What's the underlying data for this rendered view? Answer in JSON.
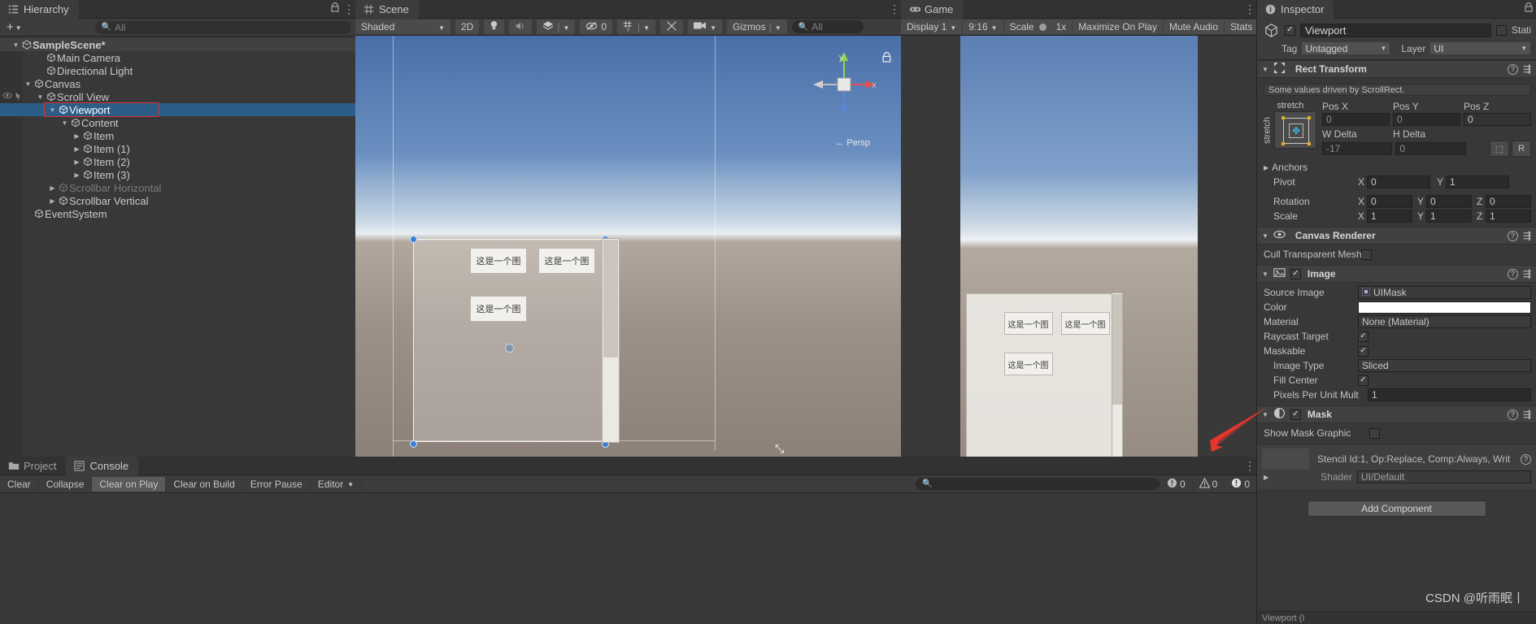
{
  "hierarchy": {
    "tab_label": "Hierarchy",
    "tab_icon": "hierarchy-icon",
    "add_label": "+",
    "search_placeholder": "All",
    "items": [
      {
        "label": "SampleScene*",
        "depth": 0,
        "tri": "down",
        "icon": "scene-icon",
        "state": "scene"
      },
      {
        "label": "Main Camera",
        "depth": 2,
        "tri": "none",
        "icon": "gameobject-icon",
        "state": "normal"
      },
      {
        "label": "Directional Light",
        "depth": 2,
        "tri": "none",
        "icon": "gameobject-icon",
        "state": "normal"
      },
      {
        "label": "Canvas",
        "depth": 1,
        "tri": "down",
        "icon": "gameobject-icon",
        "state": "normal"
      },
      {
        "label": "Scroll View",
        "depth": 2,
        "tri": "down",
        "icon": "gameobject-icon",
        "state": "normal"
      },
      {
        "label": "Viewport",
        "depth": 3,
        "tri": "down",
        "icon": "gameobject-icon",
        "state": "selected"
      },
      {
        "label": "Content",
        "depth": 4,
        "tri": "down",
        "icon": "gameobject-icon",
        "state": "normal"
      },
      {
        "label": "Item",
        "depth": 5,
        "tri": "right",
        "icon": "gameobject-icon",
        "state": "normal"
      },
      {
        "label": "Item (1)",
        "depth": 5,
        "tri": "right",
        "icon": "gameobject-icon",
        "state": "normal"
      },
      {
        "label": "Item (2)",
        "depth": 5,
        "tri": "right",
        "icon": "gameobject-icon",
        "state": "normal"
      },
      {
        "label": "Item (3)",
        "depth": 5,
        "tri": "right",
        "icon": "gameobject-icon",
        "state": "normal"
      },
      {
        "label": "Scrollbar Horizontal",
        "depth": 3,
        "tri": "right",
        "icon": "gameobject-icon",
        "state": "dim"
      },
      {
        "label": "Scrollbar Vertical",
        "depth": 3,
        "tri": "right",
        "icon": "gameobject-icon",
        "state": "normal"
      },
      {
        "label": "EventSystem",
        "depth": 1,
        "tri": "none",
        "icon": "gameobject-icon",
        "state": "normal"
      }
    ],
    "selection_highlight_color": "#e03030"
  },
  "scene": {
    "tab_label": "Scene",
    "tab_icon": "scene-grid-icon",
    "toolbar": {
      "draw_mode": "Shaded",
      "mode_2d": "2D",
      "lighting_icon": "lightbulb-icon",
      "audio_icon": "speaker-icon",
      "fx_icon": "effects-icon",
      "hidden_count": "0",
      "grid_icon": "grid-icon",
      "tools_icon": "tools-icon",
      "camera_icon": "camera-icon",
      "gizmos_label": "Gizmos",
      "search_placeholder": "All"
    },
    "gizmo": {
      "axis_x": "x",
      "axis_y": "y",
      "persp_label": "Persp"
    },
    "item_labels": [
      "这是一个图",
      "这是一个图",
      "这是一个图"
    ]
  },
  "game": {
    "tab_label": "Game",
    "tab_icon": "gamepad-icon",
    "toolbar": {
      "display": "Display 1",
      "aspect": "9:16",
      "scale_label": "Scale",
      "scale_value": "1x",
      "maximize_on_play": "Maximize On Play",
      "mute_audio": "Mute Audio",
      "stats": "Stats"
    },
    "item_labels": [
      "这是一个图",
      "这是一个图",
      "这是一个图"
    ]
  },
  "inspector": {
    "tab_label": "Inspector",
    "tab_icon": "info-icon",
    "lock_icon": "lock-icon",
    "object": {
      "enabled": true,
      "name": "Viewport",
      "static_label": "Stati",
      "static_checked": false,
      "tag_label": "Tag",
      "tag_value": "Untagged",
      "layer_label": "Layer",
      "layer_value": "UI"
    },
    "components": [
      {
        "id": "rect-transform",
        "title": "Rect Transform",
        "icon": "rect-transform-icon",
        "has_toggle": false,
        "help_box": "Some values driven by ScrollRect.",
        "anchor_preset_label": "stretch",
        "anchor_stretch_label": "stretch",
        "fields": {
          "pos_x_label": "Pos X",
          "pos_x": "0",
          "pos_y_label": "Pos Y",
          "pos_y": "0",
          "pos_z_label": "Pos Z",
          "pos_z": "0",
          "w_delta_label": "W Delta",
          "w_delta": "-17",
          "h_delta_label": "H Delta",
          "h_delta": "0",
          "anchors_label": "Anchors",
          "pivot_label": "Pivot",
          "pivot_x": "0",
          "pivot_y": "1",
          "rotation_label": "Rotation",
          "rot_x": "0",
          "rot_y": "0",
          "rot_z": "0",
          "scale_label": "Scale",
          "scale_x": "1",
          "scale_y": "1",
          "scale_z": "1"
        }
      },
      {
        "id": "canvas-renderer",
        "title": "Canvas Renderer",
        "icon": "canvas-renderer-icon",
        "has_toggle": false,
        "props": [
          {
            "label": "Cull Transparent Mesh",
            "type": "checkbox",
            "value": false
          }
        ]
      },
      {
        "id": "image",
        "title": "Image",
        "icon": "image-icon",
        "has_toggle": true,
        "enabled": true,
        "props": [
          {
            "label": "Source Image",
            "type": "object",
            "value": "UIMask"
          },
          {
            "label": "Color",
            "type": "color",
            "value": "#ffffff"
          },
          {
            "label": "Material",
            "type": "object",
            "value": "None (Material)"
          },
          {
            "label": "Raycast Target",
            "type": "checkbox",
            "value": true
          },
          {
            "label": "Maskable",
            "type": "checkbox",
            "value": true
          },
          {
            "label": "Image Type",
            "type": "dropdown",
            "value": "Sliced",
            "indent": true
          },
          {
            "label": "Fill Center",
            "type": "checkbox",
            "value": true,
            "indent": true
          },
          {
            "label": "Pixels Per Unit Mult",
            "type": "text",
            "value": "1",
            "indent": true
          }
        ]
      },
      {
        "id": "mask",
        "title": "Mask",
        "icon": "mask-icon",
        "has_toggle": true,
        "enabled": true,
        "props": [
          {
            "label": "Show Mask Graphic",
            "type": "checkbox",
            "value": false
          }
        ]
      }
    ],
    "material_info": {
      "stencil_text": "Stencil Id:1, Op:Replace, Comp:Always, Writ",
      "shader_label": "Shader",
      "shader_value": "UI/Default"
    },
    "add_component_label": "Add Component",
    "footer_label": "Viewport (I"
  },
  "console": {
    "project_tab": "Project",
    "project_icon": "folder-icon",
    "console_tab": "Console",
    "console_icon": "console-icon",
    "buttons": [
      "Clear",
      "Collapse",
      "Clear on Play",
      "Clear on Build",
      "Error Pause"
    ],
    "pressed_button": "Clear on Play",
    "editor_dropdown": "Editor",
    "search_placeholder": "",
    "counts": {
      "log": "0",
      "warning": "0",
      "error": "0"
    }
  },
  "watermark": "CSDN @听雨眠丨",
  "annotation": {
    "arrow_color": "#e03030"
  }
}
